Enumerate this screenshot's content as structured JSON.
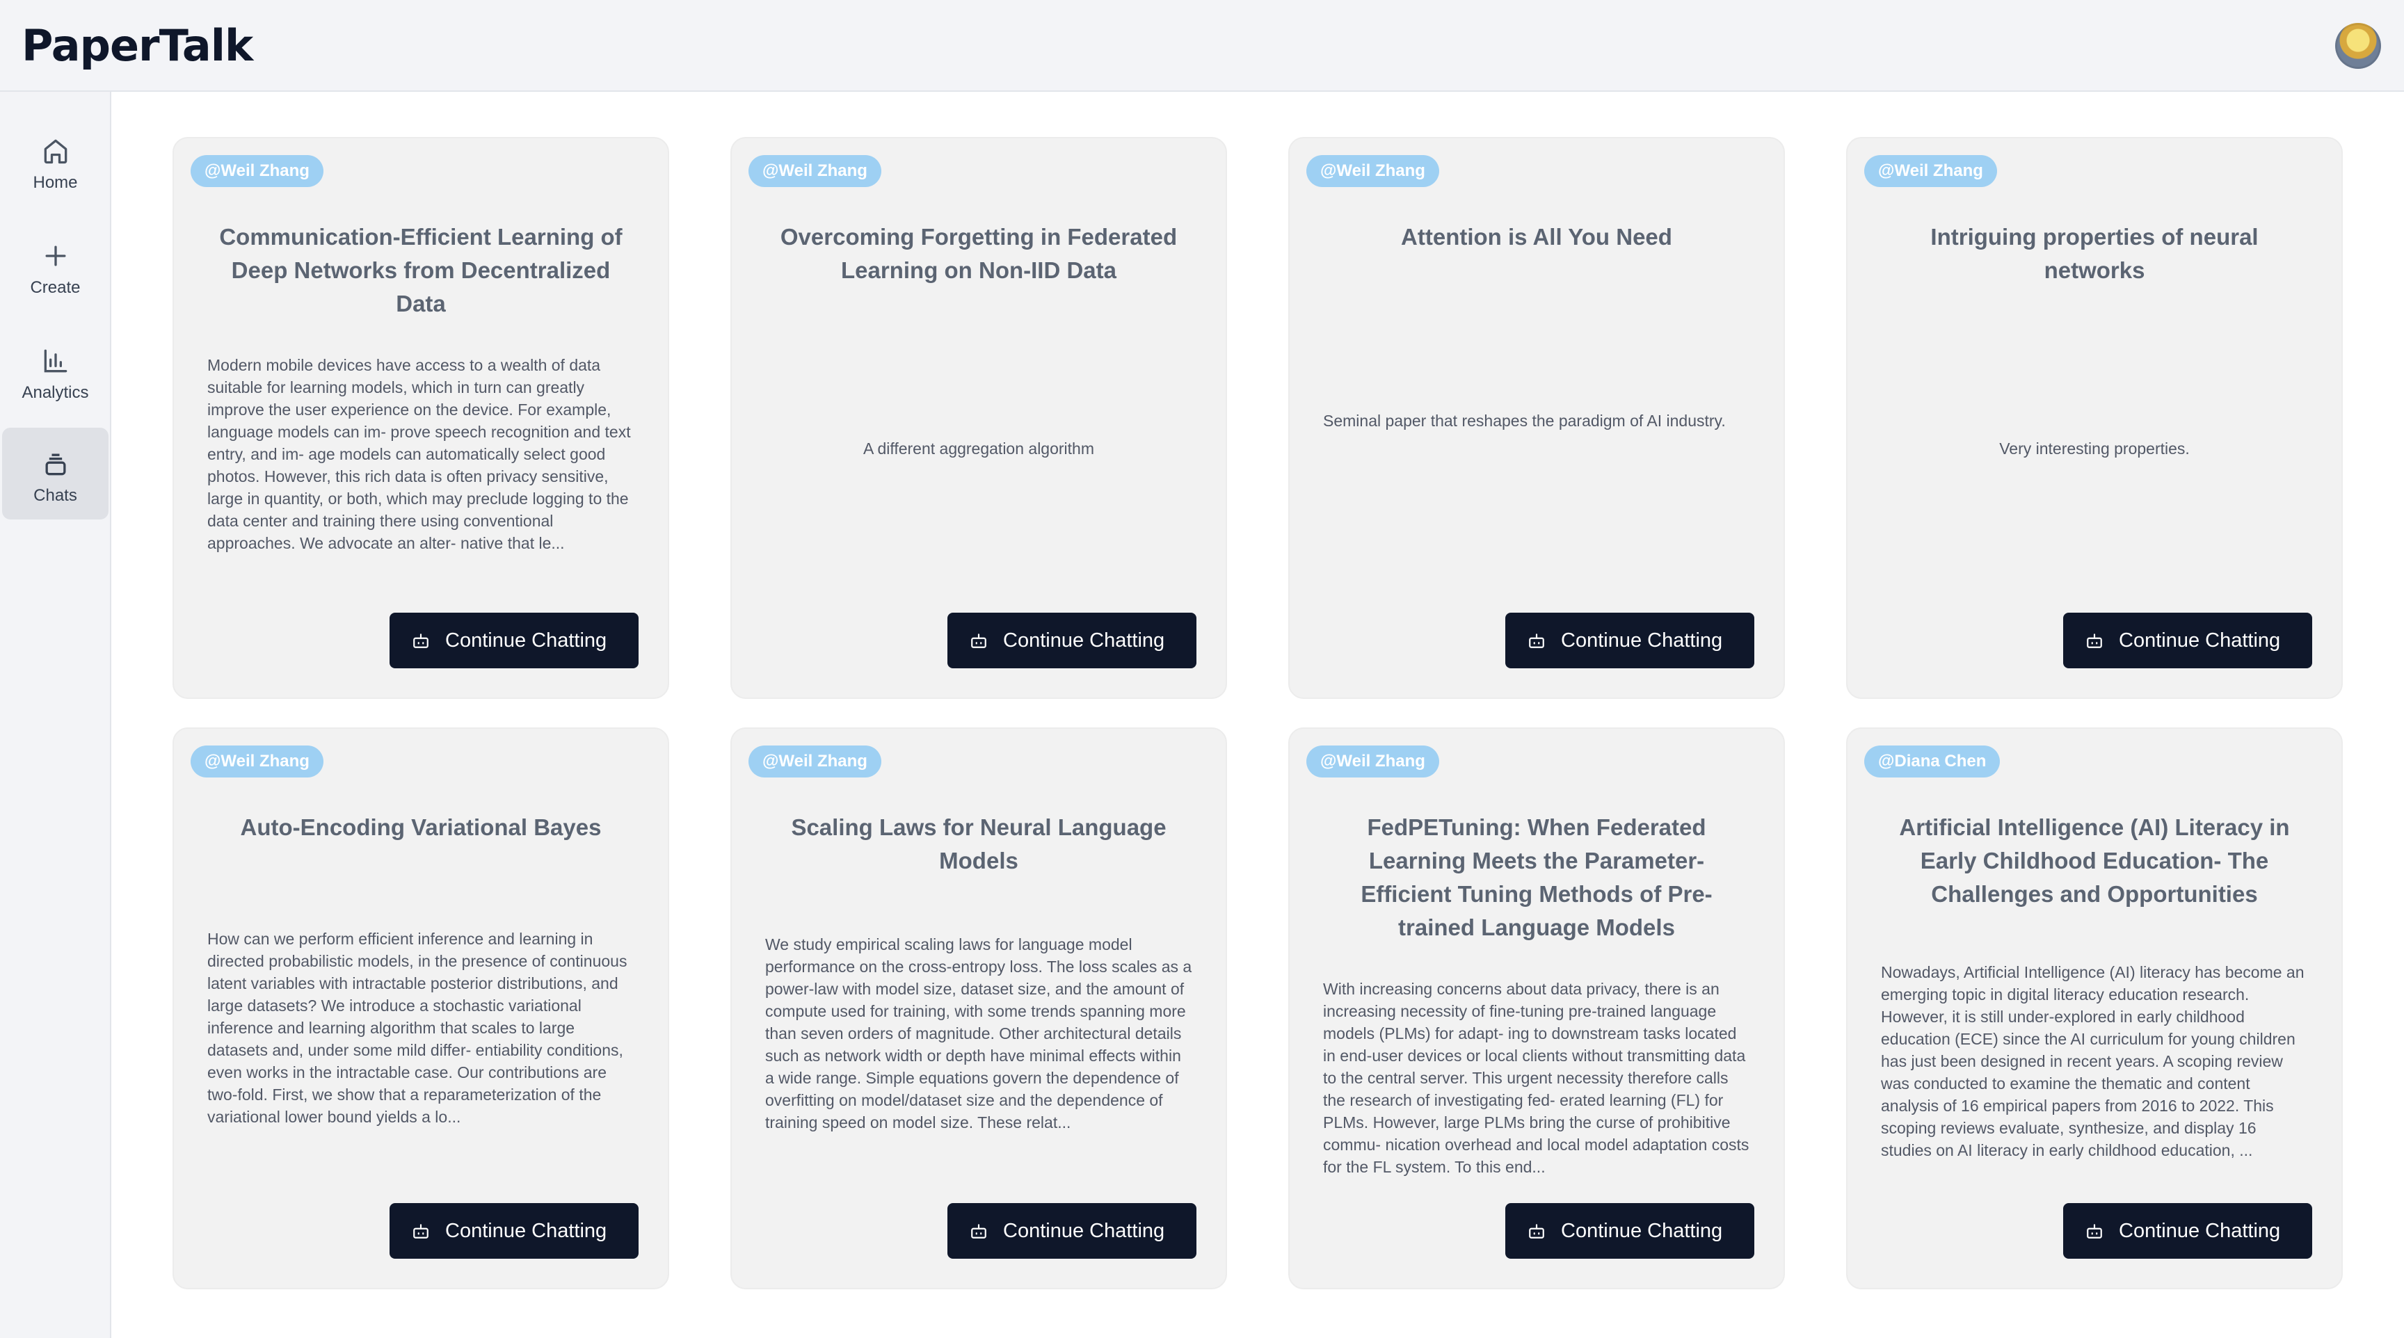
{
  "app": {
    "title": "PaperTalk"
  },
  "nav": [
    {
      "label": "Home",
      "icon": "home-icon"
    },
    {
      "label": "Create",
      "icon": "plus-icon"
    },
    {
      "label": "Analytics",
      "icon": "bar-chart-icon"
    },
    {
      "label": "Chats",
      "icon": "layers-icon",
      "active": true
    }
  ],
  "cards": [
    {
      "author": "@Weil Zhang",
      "title": "Communication-Efficient Learning of Deep Networks from Decentralized Data",
      "description": "Modern mobile devices have access to a wealth of data suitable for learning models, which in turn can greatly improve the user experience on the device. For example, language models can im- prove speech recognition and text entry, and im- age models can automatically select good photos. However, this rich data is often privacy sensitive, large in quantity, or both, which may preclude logging to the data center and training there using conventional approaches. We advocate an alter- native that le...",
      "button": "Continue Chatting"
    },
    {
      "author": "@Weil Zhang",
      "title": "Overcoming Forgetting in Federated Learning on Non-IID Data",
      "description": "A different aggregation algorithm",
      "button": "Continue Chatting"
    },
    {
      "author": "@Weil Zhang",
      "title": "Attention is All You Need",
      "description": "Seminal paper that reshapes the paradigm of AI industry.",
      "button": "Continue Chatting"
    },
    {
      "author": "@Weil Zhang",
      "title": "Intriguing properties of neural networks",
      "description": "Very interesting properties.",
      "button": "Continue Chatting"
    },
    {
      "author": "@Weil Zhang",
      "title": "Auto-Encoding Variational Bayes",
      "description": "How can we perform efficient inference and learning in directed probabilistic models, in the presence of continuous latent variables with intractable posterior distributions, and large datasets? We introduce a stochastic variational inference and learning algorithm that scales to large datasets and, under some mild differ- entiability conditions, even works in the intractable case. Our contributions are two-fold. First, we show that a reparameterization of the variational lower bound yields a lo...",
      "button": "Continue Chatting"
    },
    {
      "author": "@Weil Zhang",
      "title": "Scaling Laws for Neural Language Models",
      "description": "We study empirical scaling laws for language model performance on the cross-entropy loss. The loss scales as a power-law with model size, dataset size, and the amount of compute used for training, with some trends spanning more than seven orders of magnitude. Other architectural details such as network width or depth have minimal effects within a wide range. Simple equations govern the dependence of overfitting on model/dataset size and the dependence of training speed on model size. These relat...",
      "button": "Continue Chatting"
    },
    {
      "author": "@Weil Zhang",
      "title": "FedPETuning: When Federated Learning Meets the Parameter-Efficient Tuning Methods of Pre-trained Language Models",
      "description": "With increasing concerns about data privacy, there is an increasing necessity of fine-tuning pre-trained language models (PLMs) for adapt- ing to downstream tasks located in end-user devices or local clients without transmitting data to the central server. This urgent necessity therefore calls the research of investigating fed- erated learning (FL) for PLMs. However, large PLMs bring the curse of prohibitive commu- nication overhead and local model adaptation costs for the FL system. To this end...",
      "button": "Continue Chatting"
    },
    {
      "author": "@Diana Chen",
      "title": "Artificial Intelligence (AI) Literacy in Early Childhood Education- The Challenges and Opportunities",
      "description": "Nowadays, Artificial Intelligence (AI) literacy has become an emerging topic in digital literacy education research. However, it is still under-explored in early childhood education (ECE) since the AI curriculum for young children has just been designed in recent years. A scoping review was conducted to examine the thematic and content analysis of 16 empirical papers from 2016 to 2022. This scoping reviews evaluate, synthesize, and display 16 studies on AI literacy in early childhood education, ...",
      "button": "Continue Chatting"
    }
  ]
}
